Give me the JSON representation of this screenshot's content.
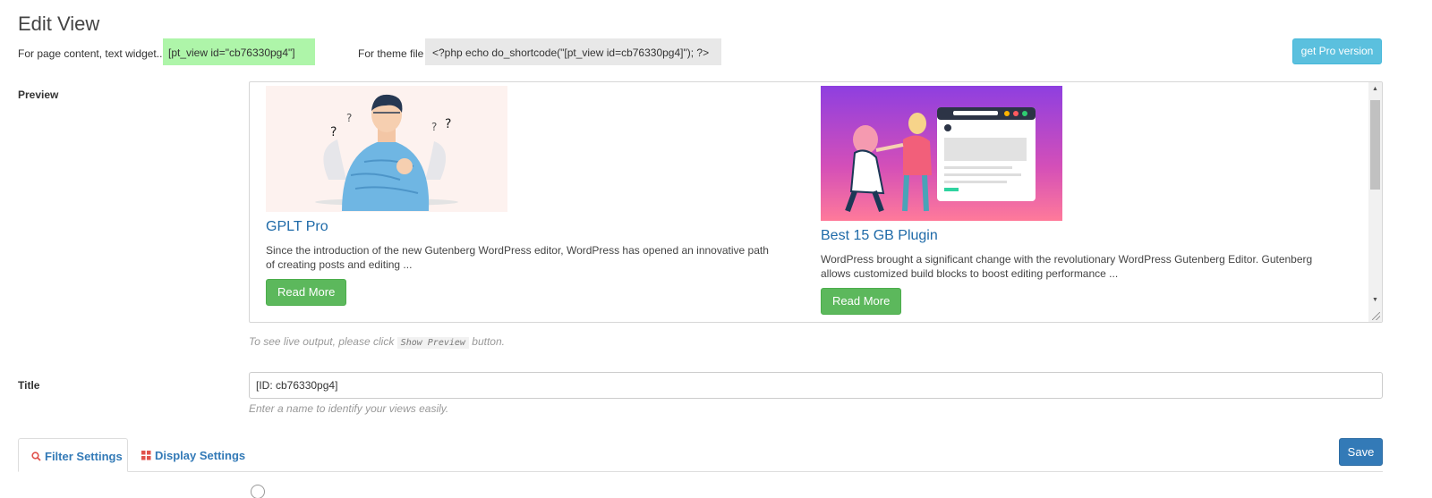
{
  "page": {
    "title": "Edit View"
  },
  "shortcode": {
    "page_content_label": "For page content, text widget...",
    "page_content_value": "[pt_view id=\"cb76330pg4\"]",
    "theme_file_label": "For theme file",
    "theme_file_value": "<?php echo do_shortcode(\"[pt_view id=cb76330pg4]\"); ?>",
    "pro_button": "get Pro version"
  },
  "preview": {
    "label": "Preview",
    "cards": [
      {
        "title": "GPLT Pro",
        "description": "Since the introduction of the new Gutenberg WordPress editor, WordPress has opened an innovative path of creating posts and editing ...",
        "button": "Read More"
      },
      {
        "title": "Best 15 GB Plugin",
        "description": "WordPress brought a significant change with the revolutionary WordPress Gutenberg Editor. Gutenberg allows customized build blocks to boost editing performance ...",
        "button": "Read More"
      }
    ],
    "hint_before": "To see live output, please click",
    "hint_code": "Show Preview",
    "hint_after": "button."
  },
  "title_field": {
    "label": "Title",
    "value": "[ID: cb76330pg4]",
    "hint": "Enter a name to identify your views easily."
  },
  "tabs": [
    {
      "label": "Filter Settings",
      "icon": "search-icon"
    },
    {
      "label": "Display Settings",
      "icon": "grid-icon"
    }
  ],
  "save_button": "Save",
  "colors": {
    "shortcode_green": "#aef5a9",
    "link_blue": "#1e6aa8",
    "read_more_green": "#5cb85c",
    "pro_button": "#5bc0de",
    "save_button": "#337ab7"
  }
}
